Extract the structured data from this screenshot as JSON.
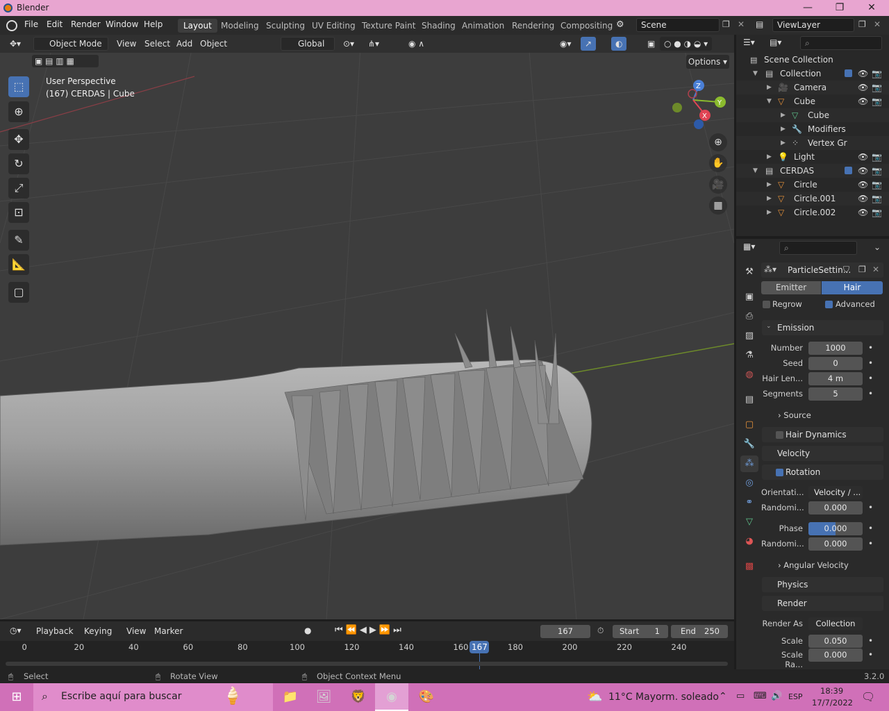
{
  "window": {
    "title": "Blender",
    "minimize": "—",
    "maximize": "❐",
    "close": "✕"
  },
  "menu": {
    "file": "File",
    "edit": "Edit",
    "render": "Render",
    "window": "Window",
    "help": "Help"
  },
  "workspaces": [
    "Layout",
    "Modeling",
    "Sculpting",
    "UV Editing",
    "Texture Paint",
    "Shading",
    "Animation",
    "Rendering",
    "Compositing"
  ],
  "scene": {
    "name": "Scene",
    "view_layer": "ViewLayer"
  },
  "viewport_header": {
    "mode": "Object Mode",
    "view": "View",
    "select": "Select",
    "add": "Add",
    "object": "Object",
    "transform": "Global",
    "options": "Options"
  },
  "viewport": {
    "perspective": "User Perspective",
    "info": "(167) CERDAS | Cube"
  },
  "gizmo": {
    "x": "X",
    "y": "Y",
    "z": "Z"
  },
  "outliner": {
    "root": "Scene Collection",
    "rows": [
      {
        "label": "Collection"
      },
      {
        "label": "Camera"
      },
      {
        "label": "Cube"
      },
      {
        "label": "Cube"
      },
      {
        "label": "Modifiers"
      },
      {
        "label": "Vertex Gr"
      },
      {
        "label": "Light"
      },
      {
        "label": "CERDAS"
      },
      {
        "label": "Circle"
      },
      {
        "label": "Circle.001"
      },
      {
        "label": "Circle.002"
      }
    ]
  },
  "properties": {
    "particle_settings": "ParticleSettin...",
    "emitter": "Emitter",
    "hair": "Hair",
    "regrow": "Regrow",
    "advanced": "Advanced",
    "emission": "Emission",
    "number_label": "Number",
    "number": "1000",
    "seed_label": "Seed",
    "seed": "0",
    "hair_len_label": "Hair Len...",
    "hair_len": "4 m",
    "segments_label": "Segments",
    "segments": "5",
    "source": "Source",
    "hair_dynamics": "Hair Dynamics",
    "velocity": "Velocity",
    "rotation": "Rotation",
    "orientation_label": "Orientati...",
    "orientation": "Velocity / ...",
    "random1_label": "Randomi...",
    "random1": "0.000",
    "phase_label": "Phase",
    "phase": "0.000",
    "random2_label": "Randomi...",
    "random2": "0.000",
    "angular_velocity": "Angular Velocity",
    "physics": "Physics",
    "render": "Render",
    "render_as_label": "Render As",
    "render_as": "Collection",
    "scale_label": "Scale",
    "scale": "0.050",
    "scale_random_label": "Scale Ra...",
    "scale_random": "0.000"
  },
  "timeline": {
    "playback": "Playback",
    "keying": "Keying",
    "view": "View",
    "marker": "Marker",
    "current_frame": "167",
    "start_label": "Start",
    "start": "1",
    "end_label": "End",
    "end": "250",
    "ticks": [
      "0",
      "20",
      "40",
      "60",
      "80",
      "100",
      "120",
      "140",
      "160",
      "180",
      "200",
      "220",
      "240"
    ],
    "playhead": "167"
  },
  "status": {
    "select": "Select",
    "rotate": "Rotate View",
    "context": "Object Context Menu",
    "version": "3.2.0"
  },
  "taskbar": {
    "search": "Escribe aquí para buscar",
    "weather": "11°C  Mayorm. soleado",
    "lang": "ESP",
    "time": "18:39",
    "date": "17/7/2022"
  }
}
